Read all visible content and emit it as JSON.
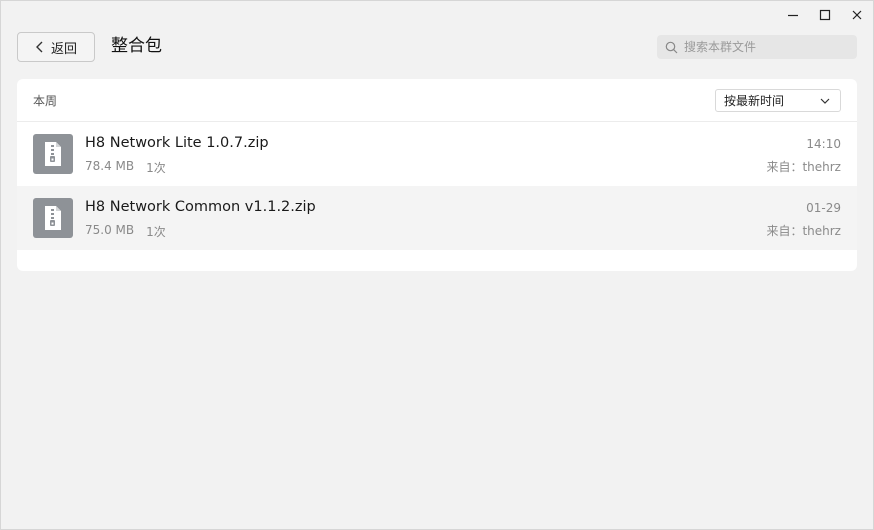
{
  "window_controls": {
    "minimize_icon": "minimize-icon",
    "maximize_icon": "maximize-icon",
    "close_icon": "close-icon"
  },
  "header": {
    "back_label": "返回",
    "title": "整合包",
    "search_placeholder": "搜索本群文件"
  },
  "panel": {
    "section_label": "本周",
    "sort_value": "按最新时间"
  },
  "files": [
    {
      "name": "H8 Network Lite 1.0.7.zip",
      "size": "78.4 MB",
      "downloads": "1次",
      "time": "14:10",
      "from": "来自：thehrz"
    },
    {
      "name": "H8 Network Common v1.1.2.zip",
      "size": "75.0 MB",
      "downloads": "1次",
      "time": "01-29",
      "from": "来自：thehrz"
    }
  ],
  "colors": {
    "background": "#f2f2f2",
    "panel": "#ffffff",
    "file_icon": "#8e9297",
    "row_alt": "#f4f4f4"
  }
}
